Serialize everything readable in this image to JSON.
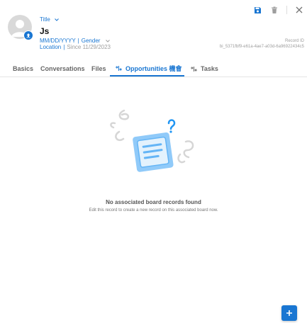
{
  "record": {
    "title_placeholder": "Title",
    "name": "Js",
    "dob_placeholder": "MM/DD/YYYY",
    "gender_placeholder": "Gender",
    "location_placeholder": "Location",
    "since": "Since 11/29/2023",
    "record_id_label": "Record ID",
    "record_id": "bi_5371fbf9-e61a-4ae7-a03d-6a96922434c5"
  },
  "tabs": [
    {
      "label": "Basics"
    },
    {
      "label": "Conversations"
    },
    {
      "label": "Files"
    },
    {
      "label": "Opportunities 機會",
      "active": true
    },
    {
      "label": "Tasks"
    }
  ],
  "empty_state": {
    "title": "No associated board records found",
    "subtitle": "Edit this record to create a new record on this associated board now."
  },
  "icons": {
    "save": "save-icon",
    "delete": "trash-icon",
    "close": "close-icon",
    "add": "plus-icon"
  },
  "colors": {
    "accent": "#1976d2",
    "muted": "#9e9e9e",
    "avatar_bg": "#d9d9d9"
  }
}
